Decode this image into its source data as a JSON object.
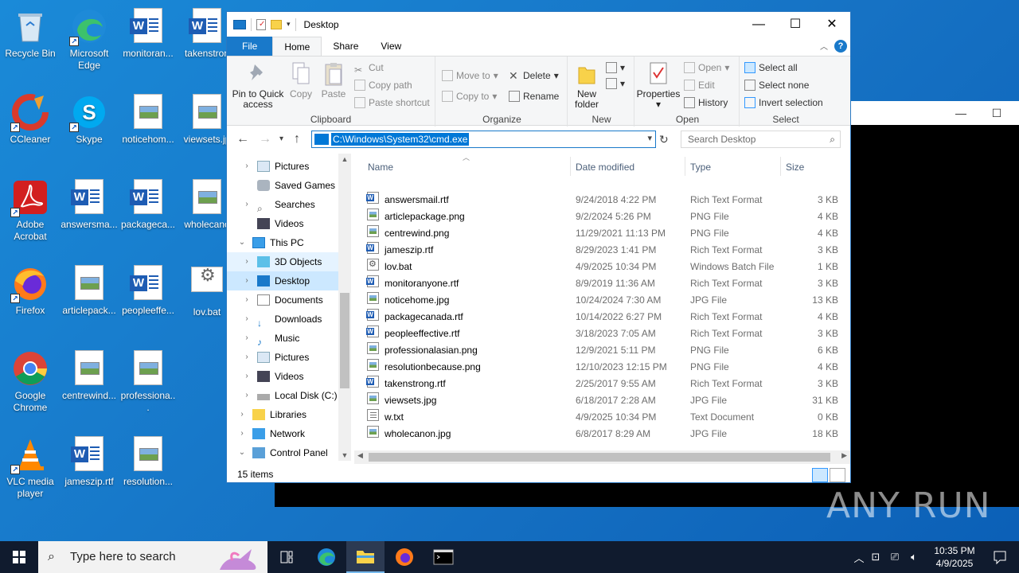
{
  "desktop": {
    "icons": [
      {
        "label": "Recycle Bin"
      },
      {
        "label": "Microsoft Edge"
      },
      {
        "label": "monitoran..."
      },
      {
        "label": "takenstron"
      },
      {
        "label": "CCleaner"
      },
      {
        "label": "Skype"
      },
      {
        "label": "noticehom..."
      },
      {
        "label": "viewsets.jp"
      },
      {
        "label": "Adobe Acrobat"
      },
      {
        "label": "answersma..."
      },
      {
        "label": "packageca..."
      },
      {
        "label": "wholecano"
      },
      {
        "label": "Firefox"
      },
      {
        "label": "articlepack..."
      },
      {
        "label": "peopleeffe..."
      },
      {
        "label": "lov.bat"
      },
      {
        "label": "Google Chrome"
      },
      {
        "label": "centrewind..."
      },
      {
        "label": "professiona..."
      },
      {
        "label": "VLC media player"
      },
      {
        "label": "jameszip.rtf"
      },
      {
        "label": "resolution..."
      }
    ]
  },
  "explorer": {
    "title": "Desktop",
    "tabs": {
      "file": "File",
      "home": "Home",
      "share": "Share",
      "view": "View"
    },
    "ribbon": {
      "clipboard": {
        "label": "Clipboard",
        "pin": "Pin to Quick access",
        "copy": "Copy",
        "paste": "Paste",
        "cut": "Cut",
        "copy_path": "Copy path",
        "paste_shortcut": "Paste shortcut"
      },
      "organize": {
        "label": "Organize",
        "move_to": "Move to",
        "copy_to": "Copy to",
        "delete": "Delete",
        "rename": "Rename"
      },
      "new": {
        "label": "New",
        "new_folder": "New folder"
      },
      "open": {
        "label": "Open",
        "properties": "Properties",
        "open": "Open",
        "edit": "Edit",
        "history": "History"
      },
      "select": {
        "label": "Select",
        "select_all": "Select all",
        "select_none": "Select none",
        "invert": "Invert selection"
      }
    },
    "address": "C:\\Windows\\System32\\cmd.exe",
    "search_placeholder": "Search Desktop",
    "nav": [
      {
        "label": "Pictures",
        "indent": 1
      },
      {
        "label": "Saved Games",
        "indent": 1
      },
      {
        "label": "Searches",
        "indent": 1
      },
      {
        "label": "Videos",
        "indent": 1
      },
      {
        "label": "This PC",
        "indent": 0
      },
      {
        "label": "3D Objects",
        "indent": 1
      },
      {
        "label": "Desktop",
        "indent": 1
      },
      {
        "label": "Documents",
        "indent": 1
      },
      {
        "label": "Downloads",
        "indent": 1
      },
      {
        "label": "Music",
        "indent": 1
      },
      {
        "label": "Pictures",
        "indent": 1
      },
      {
        "label": "Videos",
        "indent": 1
      },
      {
        "label": "Local Disk (C:)",
        "indent": 1
      },
      {
        "label": "Libraries",
        "indent": 0
      },
      {
        "label": "Network",
        "indent": 0
      },
      {
        "label": "Control Panel",
        "indent": 0
      }
    ],
    "columns": {
      "name": "Name",
      "date": "Date modified",
      "type": "Type",
      "size": "Size"
    },
    "files": [
      {
        "name": "answersmail.rtf",
        "date": "9/24/2018 4:22 PM",
        "type": "Rich Text Format",
        "size": "3 KB",
        "icon": "rtf"
      },
      {
        "name": "articlepackage.png",
        "date": "9/2/2024 5:26 PM",
        "type": "PNG File",
        "size": "4 KB",
        "icon": "img"
      },
      {
        "name": "centrewind.png",
        "date": "11/29/2021 11:13 PM",
        "type": "PNG File",
        "size": "4 KB",
        "icon": "img"
      },
      {
        "name": "jameszip.rtf",
        "date": "8/29/2023 1:41 PM",
        "type": "Rich Text Format",
        "size": "3 KB",
        "icon": "rtf"
      },
      {
        "name": "lov.bat",
        "date": "4/9/2025 10:34 PM",
        "type": "Windows Batch File",
        "size": "1 KB",
        "icon": "bat"
      },
      {
        "name": "monitoranyone.rtf",
        "date": "8/9/2019 11:36 AM",
        "type": "Rich Text Format",
        "size": "3 KB",
        "icon": "rtf"
      },
      {
        "name": "noticehome.jpg",
        "date": "10/24/2024 7:30 AM",
        "type": "JPG File",
        "size": "13 KB",
        "icon": "img"
      },
      {
        "name": "packagecanada.rtf",
        "date": "10/14/2022 6:27 PM",
        "type": "Rich Text Format",
        "size": "4 KB",
        "icon": "rtf"
      },
      {
        "name": "peopleeffective.rtf",
        "date": "3/18/2023 7:05 AM",
        "type": "Rich Text Format",
        "size": "3 KB",
        "icon": "rtf"
      },
      {
        "name": "professionalasian.png",
        "date": "12/9/2021 5:11 PM",
        "type": "PNG File",
        "size": "6 KB",
        "icon": "img"
      },
      {
        "name": "resolutionbecause.png",
        "date": "12/10/2023 12:15 PM",
        "type": "PNG File",
        "size": "4 KB",
        "icon": "img"
      },
      {
        "name": "takenstrong.rtf",
        "date": "2/25/2017 9:55 AM",
        "type": "Rich Text Format",
        "size": "3 KB",
        "icon": "rtf"
      },
      {
        "name": "viewsets.jpg",
        "date": "6/18/2017 2:28 AM",
        "type": "JPG File",
        "size": "31 KB",
        "icon": "img"
      },
      {
        "name": "w.txt",
        "date": "4/9/2025 10:34 PM",
        "type": "Text Document",
        "size": "0 KB",
        "icon": "txt"
      },
      {
        "name": "wholecanon.jpg",
        "date": "6/8/2017 8:29 AM",
        "type": "JPG File",
        "size": "18 KB",
        "icon": "img"
      }
    ],
    "status": "15 items"
  },
  "taskbar": {
    "search_placeholder": "Type here to search",
    "time": "10:35 PM",
    "date": "4/9/2025"
  },
  "watermark": "ANY RUN",
  "colors": {
    "accent": "#1979ca",
    "desktop": "#1672c4",
    "taskbar": "#101b2e"
  }
}
